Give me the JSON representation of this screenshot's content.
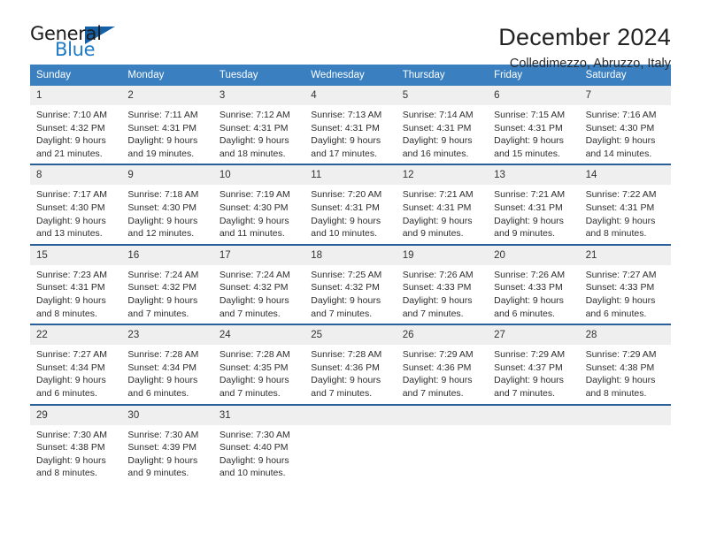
{
  "brand": {
    "name_top": "General",
    "name_bottom": "Blue",
    "accent_color": "#1f7ac4",
    "triangle_color": "#1461a8"
  },
  "header": {
    "title": "December 2024",
    "subtitle": "Colledimezzo, Abruzzo, Italy"
  },
  "theme": {
    "header_row_bg": "#3a7fc0",
    "week_divider": "#2a6099",
    "day_number_bg": "#efefef"
  },
  "weekdays": [
    "Sunday",
    "Monday",
    "Tuesday",
    "Wednesday",
    "Thursday",
    "Friday",
    "Saturday"
  ],
  "weeks": [
    [
      {
        "day": "1",
        "sunrise": "Sunrise: 7:10 AM",
        "sunset": "Sunset: 4:32 PM",
        "daylight1": "Daylight: 9 hours",
        "daylight2": "and 21 minutes."
      },
      {
        "day": "2",
        "sunrise": "Sunrise: 7:11 AM",
        "sunset": "Sunset: 4:31 PM",
        "daylight1": "Daylight: 9 hours",
        "daylight2": "and 19 minutes."
      },
      {
        "day": "3",
        "sunrise": "Sunrise: 7:12 AM",
        "sunset": "Sunset: 4:31 PM",
        "daylight1": "Daylight: 9 hours",
        "daylight2": "and 18 minutes."
      },
      {
        "day": "4",
        "sunrise": "Sunrise: 7:13 AM",
        "sunset": "Sunset: 4:31 PM",
        "daylight1": "Daylight: 9 hours",
        "daylight2": "and 17 minutes."
      },
      {
        "day": "5",
        "sunrise": "Sunrise: 7:14 AM",
        "sunset": "Sunset: 4:31 PM",
        "daylight1": "Daylight: 9 hours",
        "daylight2": "and 16 minutes."
      },
      {
        "day": "6",
        "sunrise": "Sunrise: 7:15 AM",
        "sunset": "Sunset: 4:31 PM",
        "daylight1": "Daylight: 9 hours",
        "daylight2": "and 15 minutes."
      },
      {
        "day": "7",
        "sunrise": "Sunrise: 7:16 AM",
        "sunset": "Sunset: 4:30 PM",
        "daylight1": "Daylight: 9 hours",
        "daylight2": "and 14 minutes."
      }
    ],
    [
      {
        "day": "8",
        "sunrise": "Sunrise: 7:17 AM",
        "sunset": "Sunset: 4:30 PM",
        "daylight1": "Daylight: 9 hours",
        "daylight2": "and 13 minutes."
      },
      {
        "day": "9",
        "sunrise": "Sunrise: 7:18 AM",
        "sunset": "Sunset: 4:30 PM",
        "daylight1": "Daylight: 9 hours",
        "daylight2": "and 12 minutes."
      },
      {
        "day": "10",
        "sunrise": "Sunrise: 7:19 AM",
        "sunset": "Sunset: 4:30 PM",
        "daylight1": "Daylight: 9 hours",
        "daylight2": "and 11 minutes."
      },
      {
        "day": "11",
        "sunrise": "Sunrise: 7:20 AM",
        "sunset": "Sunset: 4:31 PM",
        "daylight1": "Daylight: 9 hours",
        "daylight2": "and 10 minutes."
      },
      {
        "day": "12",
        "sunrise": "Sunrise: 7:21 AM",
        "sunset": "Sunset: 4:31 PM",
        "daylight1": "Daylight: 9 hours",
        "daylight2": "and 9 minutes."
      },
      {
        "day": "13",
        "sunrise": "Sunrise: 7:21 AM",
        "sunset": "Sunset: 4:31 PM",
        "daylight1": "Daylight: 9 hours",
        "daylight2": "and 9 minutes."
      },
      {
        "day": "14",
        "sunrise": "Sunrise: 7:22 AM",
        "sunset": "Sunset: 4:31 PM",
        "daylight1": "Daylight: 9 hours",
        "daylight2": "and 8 minutes."
      }
    ],
    [
      {
        "day": "15",
        "sunrise": "Sunrise: 7:23 AM",
        "sunset": "Sunset: 4:31 PM",
        "daylight1": "Daylight: 9 hours",
        "daylight2": "and 8 minutes."
      },
      {
        "day": "16",
        "sunrise": "Sunrise: 7:24 AM",
        "sunset": "Sunset: 4:32 PM",
        "daylight1": "Daylight: 9 hours",
        "daylight2": "and 7 minutes."
      },
      {
        "day": "17",
        "sunrise": "Sunrise: 7:24 AM",
        "sunset": "Sunset: 4:32 PM",
        "daylight1": "Daylight: 9 hours",
        "daylight2": "and 7 minutes."
      },
      {
        "day": "18",
        "sunrise": "Sunrise: 7:25 AM",
        "sunset": "Sunset: 4:32 PM",
        "daylight1": "Daylight: 9 hours",
        "daylight2": "and 7 minutes."
      },
      {
        "day": "19",
        "sunrise": "Sunrise: 7:26 AM",
        "sunset": "Sunset: 4:33 PM",
        "daylight1": "Daylight: 9 hours",
        "daylight2": "and 7 minutes."
      },
      {
        "day": "20",
        "sunrise": "Sunrise: 7:26 AM",
        "sunset": "Sunset: 4:33 PM",
        "daylight1": "Daylight: 9 hours",
        "daylight2": "and 6 minutes."
      },
      {
        "day": "21",
        "sunrise": "Sunrise: 7:27 AM",
        "sunset": "Sunset: 4:33 PM",
        "daylight1": "Daylight: 9 hours",
        "daylight2": "and 6 minutes."
      }
    ],
    [
      {
        "day": "22",
        "sunrise": "Sunrise: 7:27 AM",
        "sunset": "Sunset: 4:34 PM",
        "daylight1": "Daylight: 9 hours",
        "daylight2": "and 6 minutes."
      },
      {
        "day": "23",
        "sunrise": "Sunrise: 7:28 AM",
        "sunset": "Sunset: 4:34 PM",
        "daylight1": "Daylight: 9 hours",
        "daylight2": "and 6 minutes."
      },
      {
        "day": "24",
        "sunrise": "Sunrise: 7:28 AM",
        "sunset": "Sunset: 4:35 PM",
        "daylight1": "Daylight: 9 hours",
        "daylight2": "and 7 minutes."
      },
      {
        "day": "25",
        "sunrise": "Sunrise: 7:28 AM",
        "sunset": "Sunset: 4:36 PM",
        "daylight1": "Daylight: 9 hours",
        "daylight2": "and 7 minutes."
      },
      {
        "day": "26",
        "sunrise": "Sunrise: 7:29 AM",
        "sunset": "Sunset: 4:36 PM",
        "daylight1": "Daylight: 9 hours",
        "daylight2": "and 7 minutes."
      },
      {
        "day": "27",
        "sunrise": "Sunrise: 7:29 AM",
        "sunset": "Sunset: 4:37 PM",
        "daylight1": "Daylight: 9 hours",
        "daylight2": "and 7 minutes."
      },
      {
        "day": "28",
        "sunrise": "Sunrise: 7:29 AM",
        "sunset": "Sunset: 4:38 PM",
        "daylight1": "Daylight: 9 hours",
        "daylight2": "and 8 minutes."
      }
    ],
    [
      {
        "day": "29",
        "sunrise": "Sunrise: 7:30 AM",
        "sunset": "Sunset: 4:38 PM",
        "daylight1": "Daylight: 9 hours",
        "daylight2": "and 8 minutes."
      },
      {
        "day": "30",
        "sunrise": "Sunrise: 7:30 AM",
        "sunset": "Sunset: 4:39 PM",
        "daylight1": "Daylight: 9 hours",
        "daylight2": "and 9 minutes."
      },
      {
        "day": "31",
        "sunrise": "Sunrise: 7:30 AM",
        "sunset": "Sunset: 4:40 PM",
        "daylight1": "Daylight: 9 hours",
        "daylight2": "and 10 minutes."
      },
      {
        "day": "",
        "sunrise": "",
        "sunset": "",
        "daylight1": "",
        "daylight2": ""
      },
      {
        "day": "",
        "sunrise": "",
        "sunset": "",
        "daylight1": "",
        "daylight2": ""
      },
      {
        "day": "",
        "sunrise": "",
        "sunset": "",
        "daylight1": "",
        "daylight2": ""
      },
      {
        "day": "",
        "sunrise": "",
        "sunset": "",
        "daylight1": "",
        "daylight2": ""
      }
    ]
  ]
}
